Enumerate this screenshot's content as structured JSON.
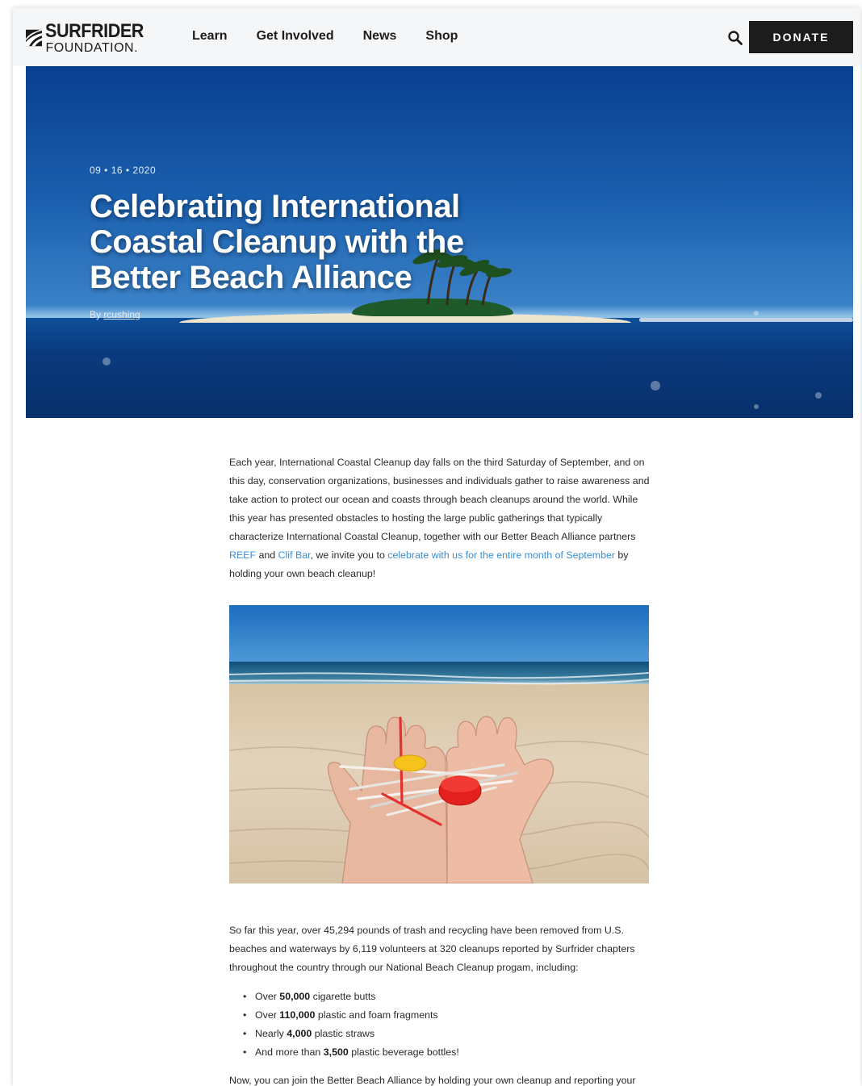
{
  "header": {
    "logo_top": "SURFRIDER",
    "logo_bottom": "FOUNDATION.",
    "nav": [
      "Learn",
      "Get Involved",
      "News",
      "Shop"
    ],
    "donate_label": "DONATE"
  },
  "hero": {
    "date": "09 • 16 • 2020",
    "title": "Celebrating International Coastal Cleanup with the Better Beach Alliance",
    "author_prefix": "By ",
    "author": "rcushing"
  },
  "article": {
    "p1_a": "Each year, International Coastal Cleanup day falls on the third Saturday of September, and on this day, conservation organizations, businesses and individuals gather to raise awareness and take action to protect our ocean and coasts through beach cleanups around the world. While this year has presented obstacles to hosting the large public gatherings that typically characterize International Coastal Cleanup, together with our Better Beach Alliance partners ",
    "link_reef": "REEF",
    "p1_b": " and ",
    "link_clifbar": "Clif Bar",
    "p1_c": ", we invite you to ",
    "link_celebrate": "celebrate with us for the entire month of September",
    "p1_d": " by holding your own beach cleanup!",
    "p2": "So far this year, over 45,294 pounds of trash and recycling have been removed from U.S. beaches and waterways by 6,119 volunteers at 320 cleanups reported by Surfrider chapters throughout the country through our National Beach Cleanup progam, including:",
    "bullets": [
      {
        "pre": "Over ",
        "num": "50,000",
        "post": " cigarette butts"
      },
      {
        "pre": "Over ",
        "num": "110,000",
        "post": " plastic and foam fragments"
      },
      {
        "pre": "Nearly ",
        "num": "4,000",
        "post": " plastic straws"
      },
      {
        "pre": "And more than ",
        "num": "3,500",
        "post": " plastic beverage bottles!"
      }
    ],
    "p3": "Now, you can join the Better Beach Alliance by holding your own cleanup and reporting your"
  },
  "colors": {
    "link": "#3a8ed3",
    "donate_bg": "#1c1c1c",
    "header_bg": "#f5f6f7"
  },
  "icons": {
    "search": "search-icon",
    "logo": "wave-logo-icon"
  }
}
